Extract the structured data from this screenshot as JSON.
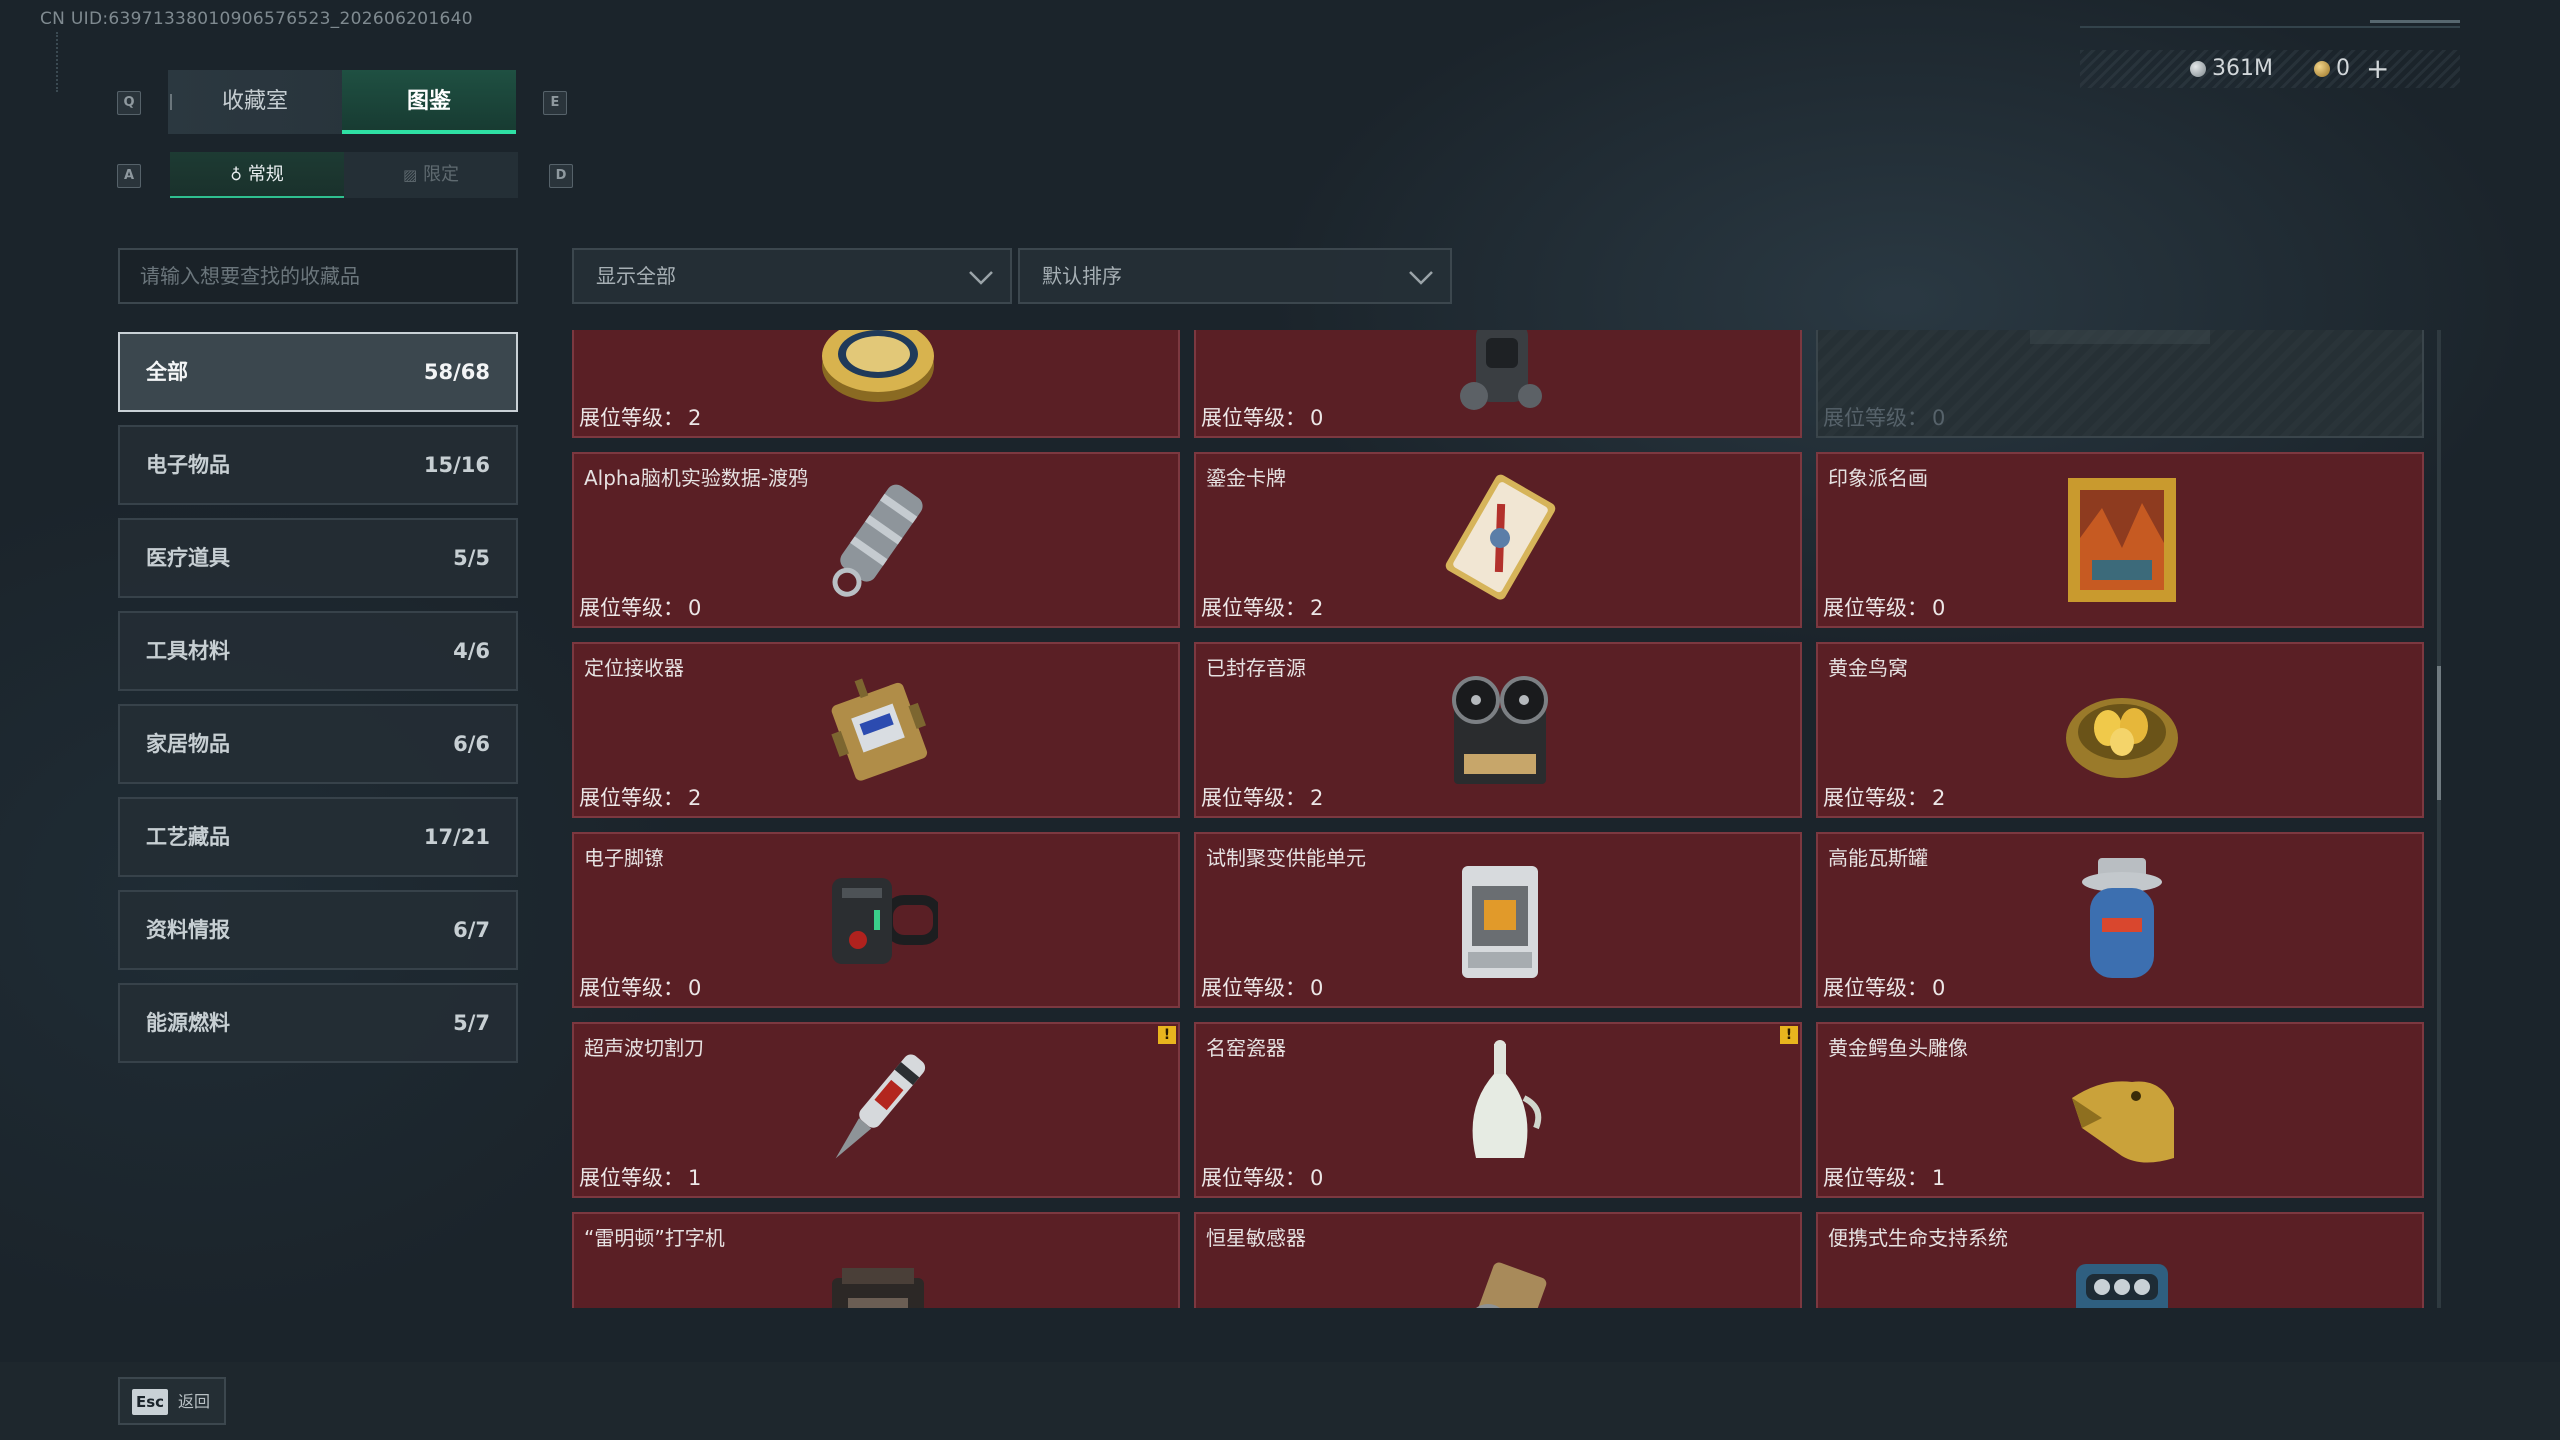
{
  "uid": "CN UID:6397133801090657652​3_202606201640",
  "currency": {
    "silver": "361M",
    "gold": "0",
    "plus": "+"
  },
  "keys": {
    "q": "Q",
    "e": "E",
    "a": "A",
    "d": "D"
  },
  "tabs": {
    "collection": "收藏室",
    "codex": "图鉴"
  },
  "subtabs": {
    "regular": "常规",
    "limited": "限定"
  },
  "search": {
    "placeholder": "请输入想要查找的收藏品"
  },
  "filters": {
    "show": "显示全部",
    "sort": "默认排序"
  },
  "categories": [
    {
      "label": "全部",
      "count": "58/68"
    },
    {
      "label": "电子物品",
      "count": "15/16"
    },
    {
      "label": "医疗道具",
      "count": "5/5"
    },
    {
      "label": "工具材料",
      "count": "4/6"
    },
    {
      "label": "家居物品",
      "count": "6/6"
    },
    {
      "label": "工艺藏品",
      "count": "17/21"
    },
    {
      "label": "资料情报",
      "count": "6/7"
    },
    {
      "label": "能源燃料",
      "count": "5/7"
    }
  ],
  "level_label": "展位等级：",
  "items": [
    {
      "name": "",
      "level": "2",
      "icon": "caviar-tin-icon"
    },
    {
      "name": "",
      "level": "0",
      "icon": "gas-mask-device-icon"
    },
    {
      "name": "",
      "level": "0",
      "icon": "locked-item-icon"
    },
    {
      "name": "Alpha脑机实验数据-渡鸦",
      "level": "0",
      "icon": "data-cylinder-icon"
    },
    {
      "name": "鎏金卡牌",
      "level": "2",
      "icon": "gilded-card-icon"
    },
    {
      "name": "印象派名画",
      "level": "0",
      "icon": "painting-icon"
    },
    {
      "name": "定位接收器",
      "level": "2",
      "icon": "locator-receiver-icon"
    },
    {
      "name": "已封存音源",
      "level": "2",
      "icon": "tape-recorder-icon"
    },
    {
      "name": "黄金鸟窝",
      "level": "2",
      "icon": "golden-nest-icon"
    },
    {
      "name": "电子脚镣",
      "level": "0",
      "icon": "ankle-monitor-icon"
    },
    {
      "name": "试制聚变供能单元",
      "level": "0",
      "icon": "fusion-cell-icon"
    },
    {
      "name": "高能瓦斯罐",
      "level": "0",
      "icon": "gas-canister-icon"
    },
    {
      "name": "超声波切割刀",
      "level": "1",
      "icon": "ultrasonic-knife-icon",
      "warn": "!"
    },
    {
      "name": "名窑瓷器",
      "level": "0",
      "icon": "porcelain-vase-icon",
      "warn": "!"
    },
    {
      "name": "黄金鳄鱼头雕像",
      "level": "1",
      "icon": "golden-croc-icon"
    },
    {
      "name": "“雷明顿”打字机",
      "level": "",
      "icon": "typewriter-icon"
    },
    {
      "name": "恒星敏感器",
      "level": "",
      "icon": "star-sensor-icon"
    },
    {
      "name": "便携式生命支持系统",
      "level": "",
      "icon": "life-support-icon"
    }
  ],
  "footer": {
    "esc_key": "Esc",
    "esc_label": "返回"
  },
  "colors": {
    "accent": "#2fe0a4",
    "card_bg": "#5a1f25",
    "card_border": "#7c3840",
    "warn": "#e8b51e"
  }
}
